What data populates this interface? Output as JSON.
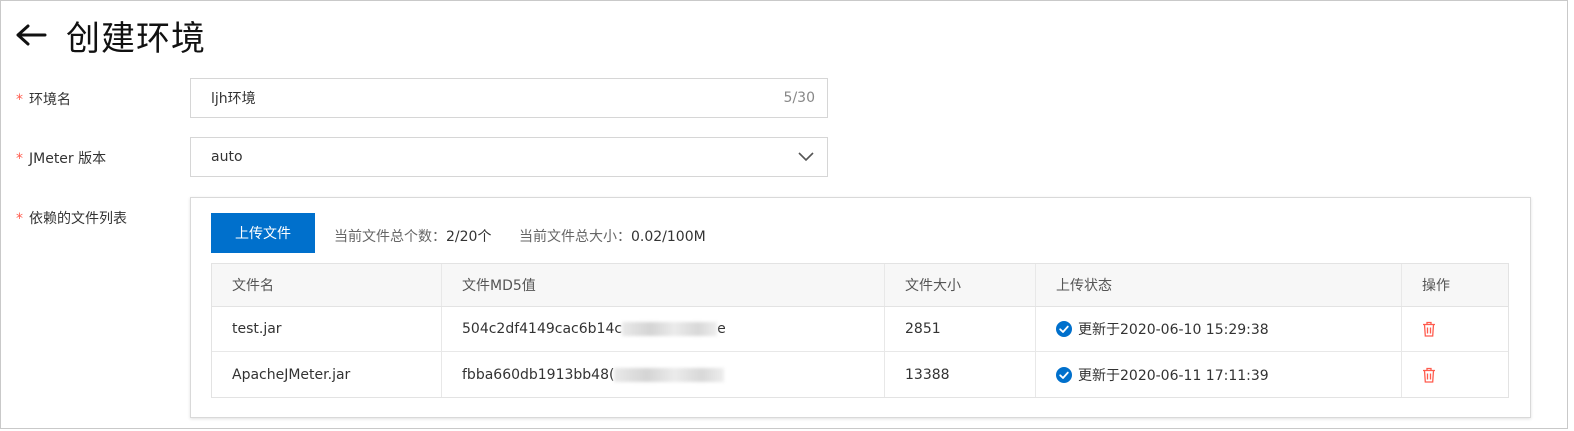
{
  "header": {
    "title": "创建环境",
    "back_icon": "arrow-left-icon"
  },
  "form": {
    "env_name": {
      "label": "环境名",
      "required_mark": "*",
      "value": "ljh环境",
      "counter": "5/30"
    },
    "jmeter_version": {
      "label": "JMeter 版本",
      "required_mark": "*",
      "selected": "auto"
    },
    "files": {
      "label": "依赖的文件列表",
      "required_mark": "*",
      "upload_label": "上传文件",
      "count_label": "当前文件总个数：",
      "count_value": "2/20个",
      "size_label": "当前文件总大小：",
      "size_value": "0.02/100M"
    }
  },
  "table": {
    "columns": [
      "文件名",
      "文件MD5值",
      "文件大小",
      "上传状态",
      "操作"
    ],
    "rows": [
      {
        "name": "test.jar",
        "md5_visible": "504c2df4149cac6b14c",
        "md5_tail": "e",
        "size": "2851",
        "status": "更新于2020-06-10 15:29:38"
      },
      {
        "name": "ApacheJMeter.jar",
        "md5_visible": "fbba660db1913bb48(",
        "md5_tail": "",
        "size": "13388",
        "status": "更新于2020-06-11 17:11:39"
      }
    ]
  },
  "colors": {
    "primary": "#0070cc",
    "required": "#ff5b4d",
    "success": "#0070cc",
    "danger": "#ff5b4d"
  }
}
